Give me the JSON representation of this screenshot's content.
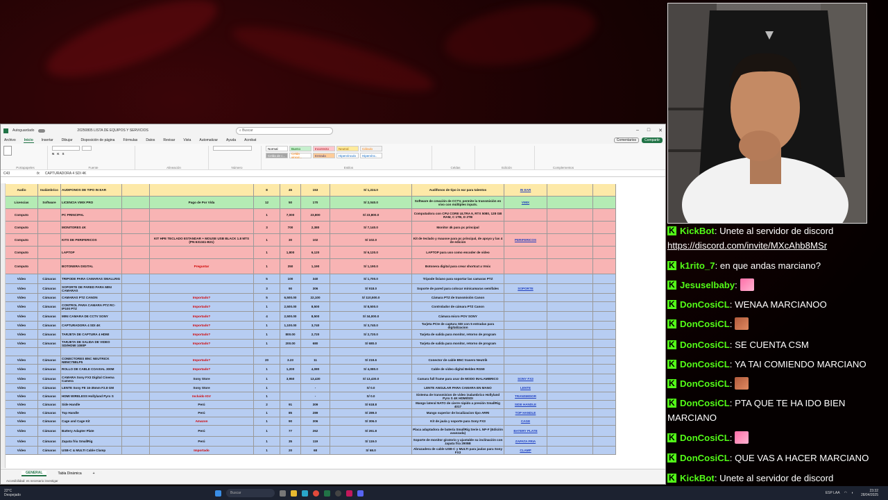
{
  "excel": {
    "title": "20250805 LISTA DE EQUIPOS Y SERVICIOS",
    "autosave": "Autoguardado",
    "search_placeholder": "Buscar",
    "menu": [
      "Archivo",
      "Inicio",
      "Insertar",
      "Dibujar",
      "Disposición de página",
      "Fórmulas",
      "Datos",
      "Revisar",
      "Vista",
      "Automatizar",
      "Ayuda",
      "Acrobat"
    ],
    "active_menu": "Inicio",
    "comments_btn": "Comentarios",
    "share_btn": "Compartir",
    "ribbon_groups": [
      "Portapapeles",
      "Fuente",
      "Alineación",
      "Número",
      "Estilos",
      "Celdas",
      "Edición",
      "Complementos"
    ],
    "styles": [
      "Normal",
      "Bueno",
      "Incorrecto",
      "Neutral",
      "Cálculo",
      "Celda de c...",
      "Celda vincul...",
      "Entrada",
      "Hipervínculo",
      "Hipervínc.."
    ],
    "name_box": "C43",
    "formula": "CAPTURADORA 4 SDI 4K",
    "sheet_tabs": [
      "GENERAL",
      "Tabla Dinámica"
    ],
    "status": "Accesibilidad: es necesario investigar",
    "rows": [
      {
        "a": "Audio",
        "b": "Inalámbrico",
        "c": "AUDIFONOS DE TIPO IN EAR",
        "d": "",
        "e": "",
        "f": "8",
        "g": "45",
        "h": "153",
        "i": "S/ 1,224.0",
        "j": "Audífonos de tipo in ear para talentos",
        "k": "IN EAR",
        "bg": "#fde9a8"
      },
      {
        "a": "Licencias",
        "b": "Software",
        "c": "LICENCIA VMIX PRO",
        "d": "",
        "e": "Pago de Por Vida",
        "f": "12",
        "g": "50",
        "h": "170",
        "i": "S/ 2,040.0",
        "j": "Software de creación de CCTV, permite la transmisión en vivo con múltiples inputs.",
        "k": "VMIX",
        "bg": "#b4ebb4"
      },
      {
        "a": "Computo",
        "b": "",
        "c": "PC PRINCIPAL",
        "d": "",
        "e": "",
        "f": "1",
        "g": "7,000",
        "h": "23,800",
        "i": "S/ 23,800.0",
        "j": "Computadora con CPU CORE ULTRA 9, RTX 5080, 128 GB RAM, C 1TB, D 2TB",
        "k": "",
        "bg": "#f8b4b4"
      },
      {
        "a": "Computo",
        "b": "",
        "c": "MONITORES 4K",
        "d": "",
        "e": "",
        "f": "3",
        "g": "700",
        "h": "2,380",
        "i": "S/ 7,140.0",
        "j": "Monitor 4k para pc principal",
        "k": "",
        "bg": "#f8b4b4"
      },
      {
        "a": "Computo",
        "b": "",
        "c": "KITS DE PERIFERICOS",
        "d": "",
        "e": "KIT HPE TECLADO ESTANDAR + MOUSE USB BLACK 1.8 MTS (PN:631341-B21)",
        "f": "1",
        "g": "30",
        "h": "102",
        "i": "S/ 102.0",
        "j": "Kit de teclado y mausse para pc principal, de apoyo y las 4 de edicion",
        "k": "PERIFERICOS",
        "bg": "#f8b4b4"
      },
      {
        "a": "Computo",
        "b": "",
        "c": "LAPTOP",
        "d": "",
        "e": "",
        "f": "1",
        "g": "1,800",
        "h": "6,120",
        "i": "S/ 6,120.0",
        "j": "LAPTOP para uso como encoder de video",
        "k": "",
        "bg": "#f8b4b4"
      },
      {
        "a": "Computo",
        "b": "",
        "c": "BOTONERA DIGITAL",
        "d": "",
        "e": "Preguntar",
        "f": "1",
        "g": "350",
        "h": "1,190",
        "i": "S/ 1,190.0",
        "j": "Botonera digital para crear shortcut a Vmix",
        "k": "",
        "bg": "#f8b4b4"
      },
      {
        "a": "Video",
        "b": "Cámaras",
        "c": "TRIPODE PARA CAMARAS SMALLRIG",
        "d": "",
        "e": "",
        "f": "5",
        "g": "100",
        "h": "340",
        "i": "S/ 1,700.0",
        "j": "Tripode liviano para soportar las camaras PTZ",
        "k": "",
        "bg": "#b7cdf2"
      },
      {
        "a": "Video",
        "b": "Cámaras",
        "c": "SOPORTE DE PARED PARA MINI CAMARAS",
        "d": "",
        "e": "",
        "f": "3",
        "g": "90",
        "h": "306",
        "i": "S/ 918.0",
        "j": "Soporte de pared para colocar minicamaras semifales",
        "k": "SOPORTE",
        "bg": "#b7cdf2"
      },
      {
        "a": "Video",
        "b": "Cámaras",
        "c": "CAMARAS PTZ CANON",
        "d": "",
        "e": "Importado?",
        "f": "5",
        "g": "6,500.00",
        "h": "22,100",
        "i": "S/ 110,500.0",
        "j": "Cámara PTZ de transmisión Canon",
        "k": "",
        "bg": "#b7cdf2"
      },
      {
        "a": "Video",
        "b": "Cámaras",
        "c": "CONTROL PARA CAMARA PTZ RC-IP100 PTZ",
        "d": "",
        "e": "Importado?",
        "f": "1",
        "g": "2,500.00",
        "h": "8,500",
        "i": "S/ 8,500.0",
        "j": "Controlador de cámara PTZ Canon",
        "k": "",
        "bg": "#b7cdf2"
      },
      {
        "a": "Video",
        "b": "Cámaras",
        "c": "MINI CAMARA DE CCTV SONY",
        "d": "",
        "e": "Importado?",
        "f": "4",
        "g": "2,500.00",
        "h": "8,500",
        "i": "S/ 34,000.0",
        "j": "Cámara micro POV SONY",
        "k": "",
        "bg": "#b7cdf2"
      },
      {
        "a": "Video",
        "b": "Cámaras",
        "c": "CAPTURADORA 4 SDI 4K",
        "d": "",
        "e": "Importado?",
        "f": "1",
        "g": "1,100.00",
        "h": "3,740",
        "i": "S/ 3,740.0",
        "j": "Tarjeta PCIe de captura SDI con 5 entradas para digitalizacion",
        "k": "",
        "bg": "#b7cdf2"
      },
      {
        "a": "Video",
        "b": "Cámaras",
        "c": "TARJETA DE CAPTURA 4 HDMI",
        "d": "",
        "e": "Importado?",
        "f": "1",
        "g": "800.00",
        "h": "2,720",
        "i": "S/ 2,720.0",
        "j": "Tarjeta de salida para monitor, retorno de program",
        "k": "",
        "bg": "#b7cdf2"
      },
      {
        "a": "Video",
        "b": "Cámaras",
        "c": "TARJETA DE SALIDA DE VIDEO SDI/HDMI 1080P",
        "d": "",
        "e": "Importado?",
        "f": "1",
        "g": "200.00",
        "h": "680",
        "i": "S/ 680.0",
        "j": "Tarjeta de salida para monitor, retorno de program",
        "k": "",
        "bg": "#b7cdf2"
      },
      {
        "a": "",
        "b": "",
        "c": "",
        "d": "",
        "e": "",
        "f": "",
        "g": "",
        "h": "",
        "i": "",
        "j": "",
        "k": "",
        "bg": "#b7cdf2"
      },
      {
        "a": "Video",
        "b": "Cámaras",
        "c": "CONECTORES BNC NEUTRICK NBNC75BLP5",
        "d": "",
        "e": "Importado?",
        "f": "20",
        "g": "3.23",
        "h": "11",
        "i": "S/ 219.6",
        "j": "Conector de cable BNC trasero Neutrik",
        "k": "",
        "bg": "#b7cdf2"
      },
      {
        "a": "Video",
        "b": "Cámaras",
        "c": "ROLLO DE CABLE COAXIAL 300M",
        "d": "",
        "e": "Importado?",
        "f": "1",
        "g": "1,200",
        "h": "4,080",
        "i": "S/ 4,080.0",
        "j": "Cable de video digital Belden RG59",
        "k": "",
        "bg": "#b7cdf2"
      },
      {
        "a": "Video",
        "b": "Cámaras",
        "c": "CAMARA  Sony FX3 Digital Cinema Camera",
        "d": "",
        "e": "Sony Store",
        "f": "1",
        "g": "3,950",
        "h": "13,430",
        "i": "S/ 13,430.0",
        "j": "Camara full frame para usar de MODO INALAMBRICO",
        "k": "SONY FX3",
        "bg": "#b7cdf2"
      },
      {
        "a": "Video",
        "b": "Cámaras",
        "c": "LENTE Sony FE 16-35mm F2.8 GM",
        "d": "",
        "e": "Sony Store",
        "f": "1",
        "g": "",
        "h": "-",
        "i": "S/ 0.0",
        "j": "LENTE ANGULAR PARA CAMARA EN MANO",
        "k": "LENTE",
        "bg": "#b7cdf2"
      },
      {
        "a": "Video",
        "b": "Cámaras",
        "c": "HDMI WIRELESS Hollyland Pyro S",
        "d": "",
        "e": "Incluido IGV",
        "f": "1",
        "g": "",
        "h": "-",
        "i": "S/ 0.0",
        "j": "Sistema de transmision de video inalambrico Hollyland Pyro S 4K HDMI/SDI",
        "k": "TRANSMISOR",
        "bg": "#b7cdf2"
      },
      {
        "a": "Video",
        "b": "Cámaras",
        "c": "Side Handle",
        "d": "",
        "e": "Perú",
        "f": "2",
        "g": "91",
        "h": "309",
        "i": "S/ 618.8",
        "j": "Mango lateral NATO de cierre rápido a presión SmallRig 4017",
        "k": "SIDE HANDLE",
        "bg": "#b7cdf2"
      },
      {
        "a": "Video",
        "b": "Cámaras",
        "c": "Top Handle",
        "d": "",
        "e": "Perú",
        "f": "1",
        "g": "85",
        "h": "289",
        "i": "S/ 289.0",
        "j": "Mango superior de localizacion tipo ARRI",
        "k": "TOP HANDLE",
        "bg": "#b7cdf2"
      },
      {
        "a": "Video",
        "b": "Cámaras",
        "c": "Cage and Cage Kit",
        "d": "",
        "e": "Amazon",
        "f": "1",
        "g": "90",
        "h": "306",
        "i": "S/ 306.0",
        "j": "Kit de jaula y soporte para Sony FX3",
        "k": "CAGE",
        "bg": "#b7cdf2"
      },
      {
        "a": "Video",
        "b": "Cámaras",
        "c": "Battery Adapter Plate",
        "d": "",
        "e": "Perú",
        "f": "1",
        "g": "77",
        "h": "262",
        "i": "S/ 261.8",
        "j": "Placa adaptadora de batería SmallRig Serie L NP-F (Edición avanzada)",
        "k": "BATERY PLATE",
        "bg": "#b7cdf2"
      },
      {
        "a": "Video",
        "b": "Cámaras",
        "c": "Zapata friu SmallRig",
        "d": "",
        "e": "Perú",
        "f": "1",
        "g": "35",
        "h": "119",
        "i": "S/ 119.0",
        "j": "Soporte de monitor giratorio y ajustable su inclinación con zapata fria 2905B",
        "k": "ZAPATA FRIA",
        "bg": "#b7cdf2"
      },
      {
        "a": "Video",
        "b": "Cámaras",
        "c": "USB-C & MULTI Cable Clamp",
        "d": "",
        "e": "Importado",
        "f": "1",
        "g": "20",
        "h": "68",
        "i": "S/ 68.0",
        "j": "Abrazadera de cable USB-C y MULTI para jaulas para Sony FX3",
        "k": "CLAMP",
        "bg": "#b7cdf2"
      }
    ]
  },
  "taskbar": {
    "weather_temp": "22°C",
    "weather_desc": "Despejado",
    "search": "Buscar",
    "time": "23:32",
    "date": "28/04/2025",
    "lang": "ESP LAA"
  },
  "chat": [
    {
      "user": "KickBot",
      "text": "Unete al servidor de discord",
      "url": "https://discord.com/invite/MXcAhb8MSr"
    },
    {
      "user": "k1rito_7",
      "text": "en que andas marciano?"
    },
    {
      "user": "Jesuselbaby",
      "emote": "pink"
    },
    {
      "user": "DonCosiCL",
      "text": "WENAA MARCIANOO"
    },
    {
      "user": "DonCosiCL",
      "emote": "face"
    },
    {
      "user": "DonCosiCL",
      "text": "SE CUENTA CSM"
    },
    {
      "user": "DonCosiCL",
      "text": "YA TAI COMIENDO MARCIANO"
    },
    {
      "user": "DonCosiCL",
      "emote": "face"
    },
    {
      "user": "DonCosiCL",
      "text": "PTA QUE TE HA IDO BIEN MARCIANO"
    },
    {
      "user": "DonCosiCL",
      "emote": "pink"
    },
    {
      "user": "DonCosiCL",
      "text": "QUE VAS A HACER MARCIANO"
    },
    {
      "user": "KickBot",
      "text": "Unete al servidor de discord",
      "url": "https://discord.com/invite/MXcAhb8MSr"
    }
  ]
}
